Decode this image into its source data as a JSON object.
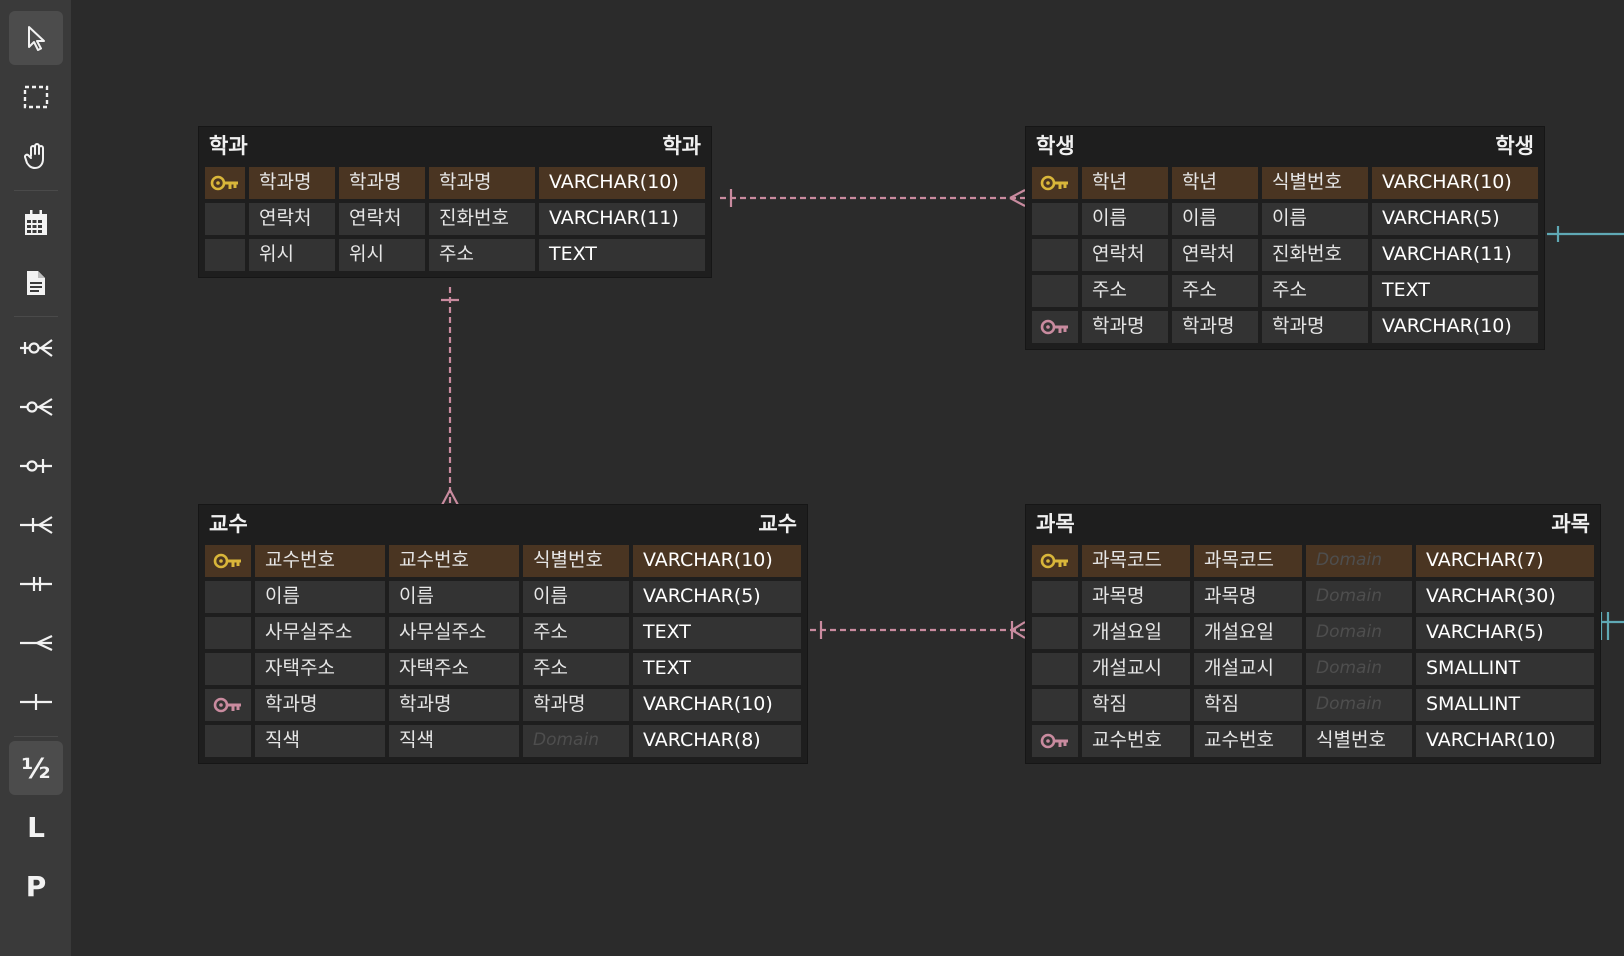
{
  "toolbar": {
    "tools": [
      {
        "name": "pointer-tool",
        "icon": "cursor-arrow-icon",
        "active": true
      },
      {
        "name": "select-area-tool",
        "icon": "dashed-rectangle-icon"
      },
      {
        "name": "hand-tool",
        "icon": "hand-icon"
      },
      {
        "name": "table-tool",
        "icon": "table-grid-icon"
      },
      {
        "name": "memo-tool",
        "icon": "document-icon"
      },
      {
        "name": "zero-one-n-tool",
        "icon": "zero-one-many-icon"
      },
      {
        "name": "zero-n-tool",
        "icon": "zero-many-icon"
      },
      {
        "name": "zero-one-tool",
        "icon": "zero-one-icon"
      },
      {
        "name": "one-n-tool",
        "icon": "one-many-icon"
      },
      {
        "name": "one-one-tool",
        "icon": "one-one-icon"
      },
      {
        "name": "n-tool",
        "icon": "many-icon"
      },
      {
        "name": "one-tool",
        "icon": "one-icon"
      },
      {
        "name": "logical-physical-toggle",
        "glyph": "½",
        "active": true
      },
      {
        "name": "logical-mode",
        "glyph": "L"
      },
      {
        "name": "physical-mode",
        "glyph": "P"
      }
    ]
  },
  "colors": {
    "relation_pink": "#c98b9f",
    "relation_teal": "#5fa9b5",
    "pk_key": "#d9b63a",
    "fk_key": "#c98b9f",
    "pk_row": "#4a3522"
  },
  "tables": [
    {
      "id": "dept",
      "name": "학과",
      "comment": "학과",
      "rows": [
        {
          "key": "pk",
          "logical": "학과명",
          "physical": "학과명",
          "domain": "학과명",
          "type": "VARCHAR(10)"
        },
        {
          "key": "",
          "logical": "연락처",
          "physical": "연락처",
          "domain": "진화번호",
          "type": "VARCHAR(11)"
        },
        {
          "key": "",
          "logical": "위시",
          "physical": "위시",
          "domain": "주소",
          "type": "TEXT"
        }
      ]
    },
    {
      "id": "student",
      "name": "학생",
      "comment": "학생",
      "rows": [
        {
          "key": "pk",
          "logical": "학년",
          "physical": "학년",
          "domain": "식별번호",
          "type": "VARCHAR(10)"
        },
        {
          "key": "",
          "logical": "이름",
          "physical": "이름",
          "domain": "이름",
          "type": "VARCHAR(5)"
        },
        {
          "key": "",
          "logical": "연락처",
          "physical": "연락처",
          "domain": "진화번호",
          "type": "VARCHAR(11)"
        },
        {
          "key": "",
          "logical": "주소",
          "physical": "주소",
          "domain": "주소",
          "type": "TEXT"
        },
        {
          "key": "fk",
          "logical": "학과명",
          "physical": "학과명",
          "domain": "학과명",
          "type": "VARCHAR(10)"
        }
      ]
    },
    {
      "id": "prof",
      "name": "교수",
      "comment": "교수",
      "rows": [
        {
          "key": "pk",
          "logical": "교수번호",
          "physical": "교수번호",
          "domain": "식별번호",
          "type": "VARCHAR(10)"
        },
        {
          "key": "",
          "logical": "이름",
          "physical": "이름",
          "domain": "이름",
          "type": "VARCHAR(5)"
        },
        {
          "key": "",
          "logical": "사무실주소",
          "physical": "사무실주소",
          "domain": "주소",
          "type": "TEXT"
        },
        {
          "key": "",
          "logical": "자택주소",
          "physical": "자택주소",
          "domain": "주소",
          "type": "TEXT"
        },
        {
          "key": "fk",
          "logical": "학과명",
          "physical": "학과명",
          "domain": "학과명",
          "type": "VARCHAR(10)"
        },
        {
          "key": "",
          "logical": "직색",
          "physical": "직색",
          "domain": "Domain",
          "domain_placeholder": true,
          "type": "VARCHAR(8)"
        }
      ]
    },
    {
      "id": "course",
      "name": "과목",
      "comment": "과목",
      "rows": [
        {
          "key": "pk",
          "logical": "과목코드",
          "physical": "과목코드",
          "domain": "Domain",
          "domain_placeholder": true,
          "type": "VARCHAR(7)"
        },
        {
          "key": "",
          "logical": "과목명",
          "physical": "과목명",
          "domain": "Domain",
          "domain_placeholder": true,
          "type": "VARCHAR(30)"
        },
        {
          "key": "",
          "logical": "개설요일",
          "physical": "개설요일",
          "domain": "Domain",
          "domain_placeholder": true,
          "type": "VARCHAR(5)"
        },
        {
          "key": "",
          "logical": "개설교시",
          "physical": "개설교시",
          "domain": "Domain",
          "domain_placeholder": true,
          "type": "SMALLINT"
        },
        {
          "key": "",
          "logical": "학짐",
          "physical": "학짐",
          "domain": "Domain",
          "domain_placeholder": true,
          "type": "SMALLINT"
        },
        {
          "key": "fk",
          "logical": "교수번호",
          "physical": "교수번호",
          "domain": "식별번호",
          "type": "VARCHAR(10)"
        }
      ]
    }
  ]
}
